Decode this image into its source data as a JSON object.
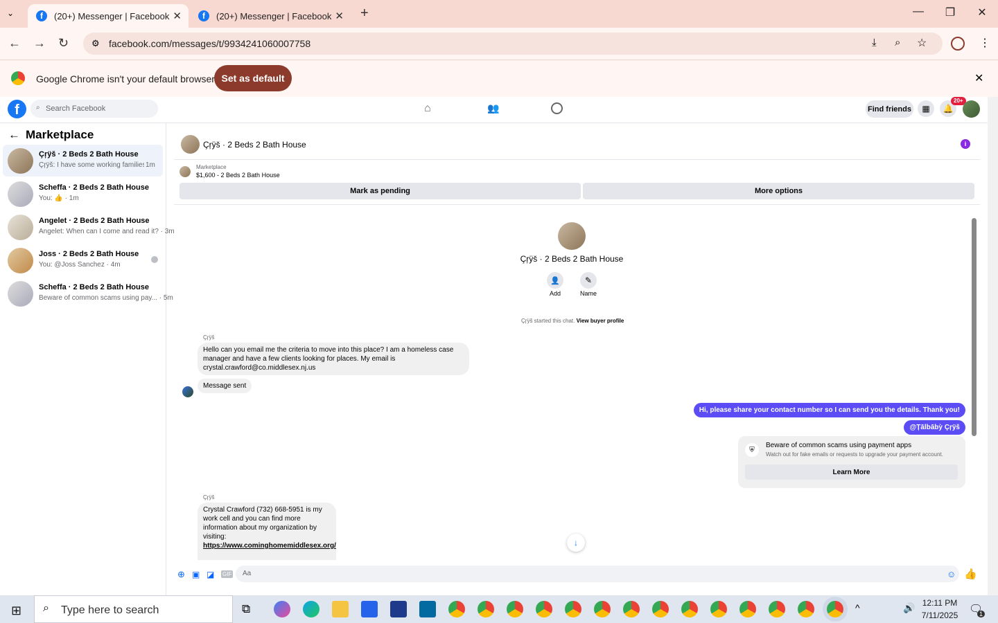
{
  "browser": {
    "tabs": [
      {
        "title": "(20+) Messenger | Facebook",
        "active": true
      },
      {
        "title": "(20+) Messenger | Facebook",
        "active": false
      }
    ],
    "url": "facebook.com/messages/t/9934241060007758",
    "infobar_text": "Google Chrome isn't your default browser",
    "set_default_label": "Set as default"
  },
  "fb": {
    "search_placeholder": "Search Facebook",
    "find_friends": "Find friends",
    "notif_badge": "20+"
  },
  "sidebar": {
    "title": "Marketplace",
    "conversations": [
      {
        "title": "Çŗÿš · 2 Beds 2 Bath House",
        "snippet": "Çŗÿš: I have some working families m...",
        "time": "1m",
        "selected": true
      },
      {
        "title": "Scheffa · 2 Beds 2 Bath House",
        "snippet": "You: 👍 · 1m",
        "time": "",
        "selected": false
      },
      {
        "title": "Angelet · 2 Beds 2 Bath House",
        "snippet": "Angelet: When can I come and read it? · 3m",
        "time": "",
        "selected": false
      },
      {
        "title": "Joss · 2 Beds 2 Bath House",
        "snippet": "You: @Joss Sanchez · 4m",
        "time": "",
        "selected": false
      },
      {
        "title": "Scheffa · 2 Beds 2 Bath House",
        "snippet": "Beware of common scams using pay... · 5m",
        "time": "",
        "selected": false
      }
    ]
  },
  "chat": {
    "header_title": "Çŗÿš · 2 Beds 2 Bath House",
    "listing_source": "Marketplace",
    "listing_price": "$1,600 - 2 Beds 2 Bath House",
    "mark_pending": "Mark as pending",
    "more_options": "More options",
    "profile_name": "Çŗÿš · 2 Beds 2 Bath House",
    "add_label": "Add",
    "name_label": "Name",
    "started_text": "Çŗÿš started this chat.",
    "view_buyer": "View buyer profile",
    "sender1": "Çŗÿš",
    "msg1": "Hello can you email me the criteria to move into this place? I am a homeless case manager and have a few clients looking for places. My email is crystal.crawford@co.middlesex.nj.us",
    "msg2": "Message sent",
    "mine1": "Hi, please share your contact number so I can send you the details. Thank you!",
    "mine2": "@Țālbābỳ Çŗÿš",
    "scam_title": "Beware of common scams using payment apps",
    "scam_body": "Watch out for fake emails or requests to upgrade your payment account.",
    "learn_more": "Learn More",
    "sender2": "Çŗÿš",
    "msg3": "Crystal Crawford (732) 668-5951 is my work cell and you can find more information about my organization by visiting:",
    "msg3_link": "https://www.cominghomemiddlesex.org/",
    "composer_placeholder": "Aa"
  },
  "taskbar": {
    "search_placeholder": "Type here to search",
    "time": "12:11 PM",
    "date": "7/11/2025",
    "notif_count": "1"
  }
}
